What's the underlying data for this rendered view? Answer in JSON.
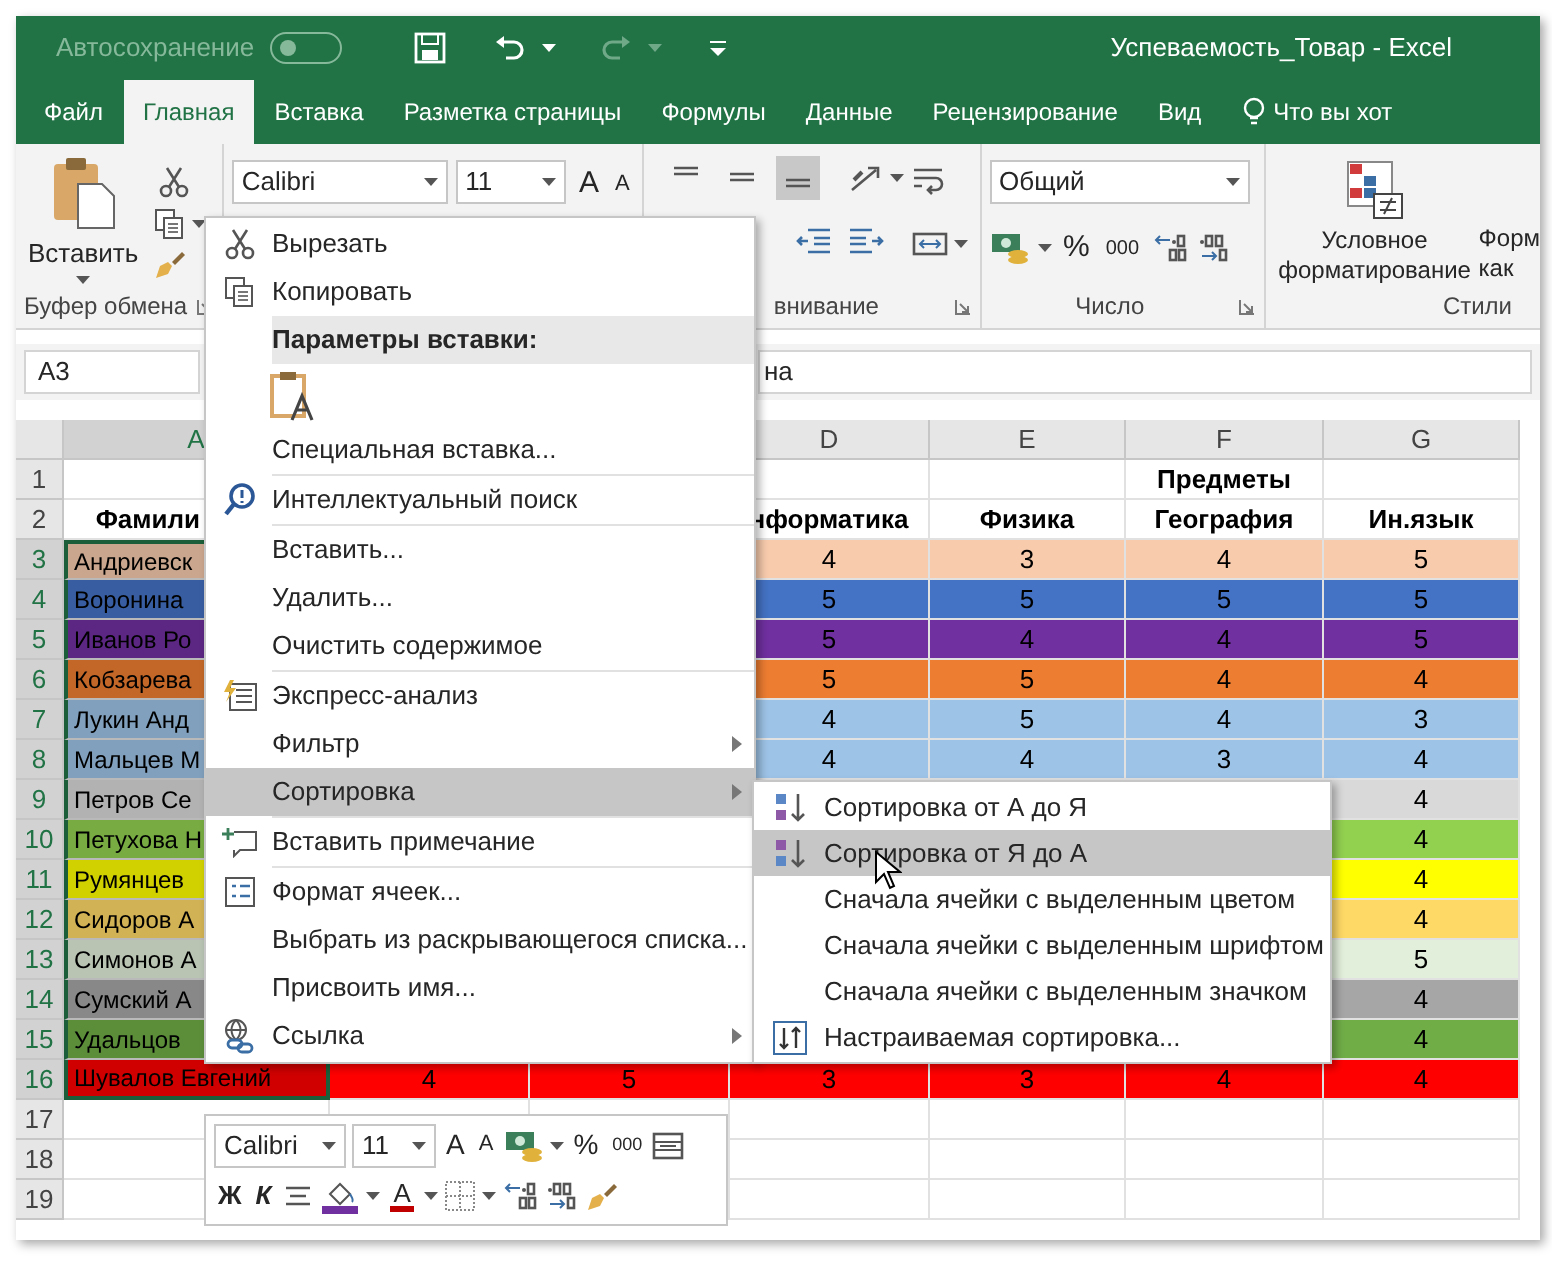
{
  "title_bar": {
    "autosave": {
      "label": "Автосохранение",
      "on": false
    },
    "title": "Успеваемость_Товар  -  Excel"
  },
  "tabs": [
    {
      "label": "Файл",
      "selected": false
    },
    {
      "label": "Главная",
      "selected": true
    },
    {
      "label": "Вставка",
      "selected": false
    },
    {
      "label": "Разметка страницы",
      "selected": false
    },
    {
      "label": "Формулы",
      "selected": false
    },
    {
      "label": "Данные",
      "selected": false
    },
    {
      "label": "Рецензирование",
      "selected": false
    },
    {
      "label": "Вид",
      "selected": false
    }
  ],
  "tell_me": "Что вы хот",
  "ribbon": {
    "clipboard": {
      "paste": "Вставить",
      "label": "Буфер обмена"
    },
    "font": {
      "name": "Calibri",
      "size": "11",
      "grow": "A",
      "shrink": "A"
    },
    "alignment": {
      "buttons": [
        {
          "kind": "top",
          "selected": false
        },
        {
          "kind": "middle",
          "selected": false
        },
        {
          "kind": "bottom",
          "selected": true
        }
      ],
      "label": "внивание"
    },
    "number": {
      "format": "Общий",
      "percent": "%",
      "thousands": "000",
      "label": "Число"
    },
    "styles": {
      "conditional": "Условное форматирование",
      "format_table": [
        "Форм",
        "как"
      ],
      "label": "Стили"
    }
  },
  "formula_bar": {
    "name_box": "A3",
    "value": "на"
  },
  "sheet": {
    "columns": [
      "A",
      null,
      null,
      "D",
      "E",
      "F",
      "G"
    ],
    "rows": [
      {
        "number": "1",
        "kind": "header",
        "cells": [
          null,
          null,
          null,
          null,
          null,
          {
            "text": "Предметы",
            "selected": false
          },
          null
        ]
      },
      {
        "number": "2",
        "kind": "header",
        "cells": [
          {
            "text": "Фамили",
            "selected": false
          },
          null,
          null,
          {
            "text": "нформатика",
            "selected": false
          },
          {
            "text": "Физика",
            "selected": false
          },
          {
            "text": "География",
            "selected": false
          },
          {
            "text": "Ин.язык",
            "selected": false
          }
        ]
      },
      {
        "number": "3",
        "kind": "data",
        "color": "#f8cbad",
        "cells": [
          {
            "text": "Андриевск",
            "selected": true
          },
          null,
          null,
          {
            "text": "4",
            "selected": false
          },
          {
            "text": "3",
            "selected": false
          },
          {
            "text": "4",
            "selected": false
          },
          {
            "text": "5",
            "selected": false
          }
        ]
      },
      {
        "number": "4",
        "kind": "data",
        "color": "#4472c4",
        "cells": [
          {
            "text": "Воронина",
            "selected": true
          },
          null,
          null,
          {
            "text": "5",
            "selected": false
          },
          {
            "text": "5",
            "selected": false
          },
          {
            "text": "5",
            "selected": false
          },
          {
            "text": "5",
            "selected": false
          }
        ]
      },
      {
        "number": "5",
        "kind": "data",
        "color": "#7030a0",
        "cells": [
          {
            "text": "Иванов Ро",
            "selected": true
          },
          null,
          null,
          {
            "text": "5",
            "selected": false
          },
          {
            "text": "4",
            "selected": false
          },
          {
            "text": "4",
            "selected": false
          },
          {
            "text": "5",
            "selected": false
          }
        ]
      },
      {
        "number": "6",
        "kind": "data",
        "color": "#ed7d31",
        "cells": [
          {
            "text": "Кобзарева",
            "selected": true
          },
          null,
          null,
          {
            "text": "5",
            "selected": false
          },
          {
            "text": "5",
            "selected": false
          },
          {
            "text": "4",
            "selected": false
          },
          {
            "text": "4",
            "selected": false
          }
        ]
      },
      {
        "number": "7",
        "kind": "data",
        "color": "#9dc3e6",
        "cells": [
          {
            "text": "Лукин Анд",
            "selected": true
          },
          null,
          null,
          {
            "text": "4",
            "selected": false
          },
          {
            "text": "5",
            "selected": false
          },
          {
            "text": "4",
            "selected": false
          },
          {
            "text": "3",
            "selected": false
          }
        ]
      },
      {
        "number": "8",
        "kind": "data",
        "color": "#9dc3e6",
        "cells": [
          {
            "text": "Мальцев М",
            "selected": true
          },
          null,
          null,
          {
            "text": "4",
            "selected": false
          },
          {
            "text": "4",
            "selected": false
          },
          {
            "text": "3",
            "selected": false
          },
          {
            "text": "4",
            "selected": false
          }
        ]
      },
      {
        "number": "9",
        "kind": "data",
        "color": "#d9d9d9",
        "cells": [
          {
            "text": "Петров Се",
            "selected": true
          },
          null,
          null,
          null,
          null,
          null,
          {
            "text": "4",
            "selected": false
          }
        ]
      },
      {
        "number": "10",
        "kind": "data",
        "color": "#92d050",
        "cells": [
          {
            "text": "Петухова Н",
            "selected": true
          },
          null,
          null,
          null,
          null,
          null,
          {
            "text": "4",
            "selected": false
          }
        ]
      },
      {
        "number": "11",
        "kind": "data",
        "color": "#ffff00",
        "cells": [
          {
            "text": "Румянцев",
            "selected": true
          },
          null,
          null,
          null,
          null,
          null,
          {
            "text": "4",
            "selected": false
          }
        ]
      },
      {
        "number": "12",
        "kind": "data",
        "color": "#ffd966",
        "cells": [
          {
            "text": "Сидоров А",
            "selected": true
          },
          null,
          null,
          null,
          null,
          null,
          {
            "text": "4",
            "selected": false
          }
        ]
      },
      {
        "number": "13",
        "kind": "data",
        "color": "#e2efda",
        "cells": [
          {
            "text": "Симонов А",
            "selected": true
          },
          null,
          null,
          null,
          null,
          null,
          {
            "text": "5",
            "selected": false
          }
        ]
      },
      {
        "number": "14",
        "kind": "data",
        "color": "#a6a6a6",
        "cells": [
          {
            "text": "Сумский А",
            "selected": true
          },
          null,
          null,
          null,
          null,
          null,
          {
            "text": "4",
            "selected": false
          }
        ]
      },
      {
        "number": "15",
        "kind": "data",
        "color": "#70ad47",
        "cells": [
          {
            "text": "Удальцов",
            "selected": true
          },
          null,
          null,
          null,
          null,
          null,
          {
            "text": "4",
            "selected": false
          }
        ]
      },
      {
        "number": "16",
        "kind": "data",
        "color": "#ff0000",
        "cells": [
          {
            "text": "Шувалов Евгений",
            "selected": true
          },
          {
            "text": "4",
            "selected": false
          },
          {
            "text": "5",
            "selected": false
          },
          {
            "text": "3",
            "selected": false
          },
          {
            "text": "3",
            "selected": false
          },
          {
            "text": "4",
            "selected": false
          },
          {
            "text": "4",
            "selected": false
          }
        ]
      },
      {
        "number": "17",
        "kind": "empty"
      },
      {
        "number": "18",
        "kind": "empty"
      },
      {
        "number": "19",
        "kind": "empty"
      }
    ]
  },
  "context_menu": [
    {
      "kind": "cut",
      "label": "Вырезать",
      "selected": false
    },
    {
      "kind": "copy",
      "label": "Копировать",
      "selected": false
    },
    {
      "kind": "heading",
      "label": "Параметры вставки:"
    },
    {
      "kind": "paste-option",
      "selected": false
    },
    {
      "kind": "plain",
      "label": "Специальная вставка...",
      "selected": false,
      "separator_after": true
    },
    {
      "kind": "lookup",
      "label": "Интеллектуальный поиск",
      "selected": false,
      "separator_after": true
    },
    {
      "kind": "plain",
      "label": "Вставить...",
      "selected": false
    },
    {
      "kind": "plain",
      "label": "Удалить...",
      "selected": false
    },
    {
      "kind": "plain",
      "label": "Очистить содержимое",
      "selected": false,
      "separator_after": true
    },
    {
      "kind": "quick-analysis",
      "label": "Экспресс-анализ",
      "selected": false
    },
    {
      "kind": "plain",
      "label": "Фильтр",
      "selected": false,
      "submenu": true
    },
    {
      "kind": "plain",
      "label": "Сортировка",
      "selected": true,
      "submenu": true,
      "separator_after": true
    },
    {
      "kind": "comment",
      "label": "Вставить примечание",
      "selected": false,
      "separator_after": true
    },
    {
      "kind": "format-cells",
      "label": "Формат ячеек...",
      "selected": false
    },
    {
      "kind": "plain",
      "label": "Выбрать из раскрывающегося списка...",
      "selected": false
    },
    {
      "kind": "plain",
      "label": "Присвоить имя...",
      "selected": false
    },
    {
      "kind": "link",
      "label": "Ссылка",
      "selected": false,
      "submenu": true
    }
  ],
  "submenu": [
    {
      "kind": "sort-asc",
      "label": "Сортировка от А до Я",
      "selected": false
    },
    {
      "kind": "sort-desc",
      "label": "Сортировка от Я до А",
      "selected": true
    },
    {
      "kind": "plain",
      "label": "Сначала ячейки с выделенным цветом",
      "selected": false
    },
    {
      "kind": "plain",
      "label": "Сначала ячейки с выделенным шрифтом",
      "selected": false
    },
    {
      "kind": "plain",
      "label": "Сначала ячейки с выделенным значком",
      "selected": false
    },
    {
      "kind": "custom-sort",
      "label": "Настраиваемая сортировка...",
      "selected": false
    }
  ],
  "mini_toolbar": {
    "font": "Calibri",
    "size": "11",
    "grow": "A",
    "shrink": "A",
    "percent": "%",
    "thousands": "000",
    "bold": "Ж",
    "italic": "К",
    "font_color": "A"
  }
}
